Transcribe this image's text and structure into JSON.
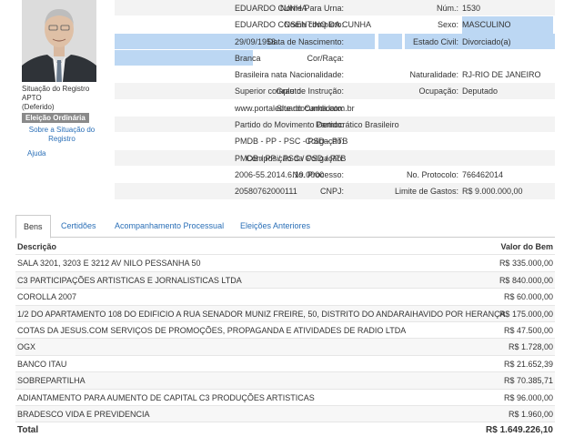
{
  "candidate": {
    "status_label": "Situação do Registro",
    "status_value": "APTO",
    "status_detail": "(Deferido)",
    "election_badge": "Eleição Ordinária",
    "link_situacao": "Sobre a Situação do Registro",
    "link_ajuda": "Ajuda"
  },
  "info": {
    "nome_urna_label": "Nome Para Urna:",
    "nome_urna": "EDUARDO CUNHA",
    "num_label": "Núm.:",
    "num": "1530",
    "nome_completo_label": "Nome completo:",
    "nome_completo": "EDUARDO COSENTINO DA CUNHA",
    "sexo_label": "Sexo:",
    "sexo": "MASCULINO",
    "nascimento_label": "Data de Nascimento:",
    "nascimento": "29/09/1958",
    "estado_civil_label": "Estado Civil:",
    "estado_civil": "Divorciado(a)",
    "cor_label": "Cor/Raça:",
    "cor": "Branca",
    "nacionalidade_label": "Nacionalidade:",
    "nacionalidade": "Brasileira nata",
    "naturalidade_label": "Naturalidade:",
    "naturalidade": "RJ-RIO DE JANEIRO",
    "instrucao_label": "Grau de Instrução:",
    "instrucao": "Superior completo",
    "ocupacao_label": "Ocupação:",
    "ocupacao": "Deputado",
    "site_label": "Site do Candidato:",
    "site": "www.portaleduardocunha.com.br",
    "partido_label": "Partido:",
    "partido": "Partido do Movimento Democrático Brasileiro",
    "coligacao_label": "Coligação:",
    "coligacao": "PMDB - PP - PSC - PSD - PTB",
    "composicao_label": "Composição da Coligação:",
    "composicao": "PMDB / PP / PSC / PSD / PTB",
    "processo_label": "No. Processo:",
    "processo": "2006-55.2014.6.19.0000",
    "protocolo_label": "No. Protocolo:",
    "protocolo": "766462014",
    "cnpj_label": "CNPJ:",
    "cnpj": "20580762000111",
    "limite_label": "Limite de Gastos:",
    "limite": "R$ 9.000.000,00"
  },
  "tabs": [
    {
      "label": "Bens"
    },
    {
      "label": "Certidões"
    },
    {
      "label": "Acompanhamento Processual"
    },
    {
      "label": "Eleições Anteriores"
    }
  ],
  "bens": {
    "col_desc": "Descrição",
    "col_val": "Valor do Bem",
    "rows": [
      {
        "desc": "SALA 3201, 3203 E 3212 AV NILO PESSANHA 50",
        "val": "R$ 335.000,00"
      },
      {
        "desc": "C3 PARTICIPAÇÕES ARTISTICAS E JORNALISTICAS LTDA",
        "val": "R$ 840.000,00"
      },
      {
        "desc": "COROLLA 2007",
        "val": "R$ 60.000,00"
      },
      {
        "desc": "1/2 DO APARTAMENTO 108 DO EDIFICIO A RUA SENADOR MUNIZ FREIRE, 50, DISTRITO DO ANDARAIHAVIDO POR HERANÇA",
        "val": "R$ 175.000,00"
      },
      {
        "desc": "COTAS DA JESUS.COM SERVIÇOS DE PROMOÇÕES, PROPAGANDA E ATIVIDADES DE RADIO LTDA",
        "val": "R$ 47.500,00"
      },
      {
        "desc": "OGX",
        "val": "R$ 1.728,00"
      },
      {
        "desc": "BANCO ITAU",
        "val": "R$ 21.652,39"
      },
      {
        "desc": "SOBREPARTILHA",
        "val": "R$ 70.385,71"
      },
      {
        "desc": "ADIANTAMENTO PARA AUMENTO DE CAPITAL C3 PRODUÇÕES ARTISTICAS",
        "val": "R$ 96.000,00"
      },
      {
        "desc": "BRADESCO VIDA E PREVIDENCIA",
        "val": "R$ 1.960,00"
      }
    ],
    "total_label": "Total",
    "total_val": "R$ 1.649.226,10"
  }
}
